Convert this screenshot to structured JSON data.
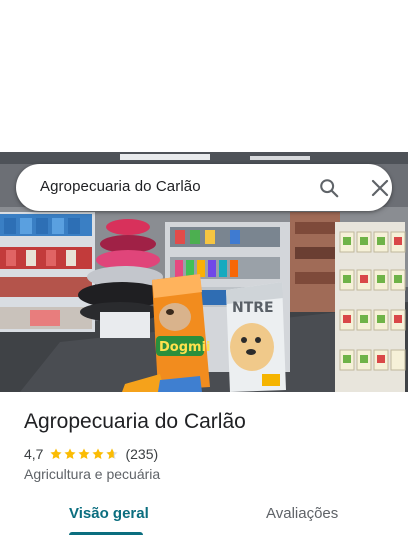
{
  "search": {
    "query": "Agropecuaria do Carlão",
    "search_icon": "search-icon",
    "close_icon": "close-icon"
  },
  "photo": {
    "bag_brand_left": "Dogmii",
    "bag_brand_right": "NTRE"
  },
  "place": {
    "name": "Agropecuaria do Carlão",
    "rating": "4,7",
    "stars": 4.7,
    "review_count": "(235)",
    "category": "Agricultura e pecuária"
  },
  "tabs": [
    {
      "label": "Visão geral",
      "active": true
    },
    {
      "label": "Avaliações",
      "active": false
    }
  ],
  "colors": {
    "accent": "#0b6e7f",
    "star": "#fbbc04",
    "text_primary": "#202124",
    "text_secondary": "#5f6368"
  }
}
